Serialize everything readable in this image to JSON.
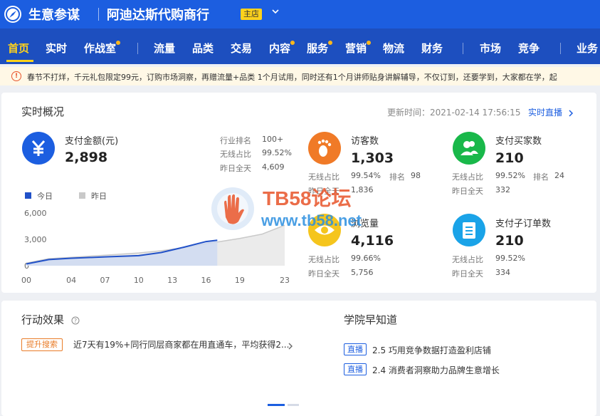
{
  "header": {
    "app_title": "生意参谋",
    "shop_name": "阿迪达斯代购商行",
    "shop_badge": "主店",
    "logo_icon": "compass-icon",
    "dropdown_icon": "chevron-down-icon"
  },
  "nav": {
    "items": [
      "首页",
      "实时",
      "作战室",
      "流量",
      "品类",
      "交易",
      "内容",
      "服务",
      "营销",
      "物流",
      "财务",
      "市场",
      "竞争",
      "业务"
    ],
    "active": "首页",
    "accent": "#ffd21c"
  },
  "notice": {
    "icon": "info-icon",
    "text": "春节不打烊，千元礼包限定99元，订购市场洞察，再赠流量+品类 1个月试用，同时还有1个月讲师贴身讲解辅导，不仅订到，还要学到，大家都在学，起"
  },
  "realtime": {
    "title": "实时概况",
    "update_time": "更新时间：2021-02-14 17:56:15",
    "live_link": "实时直播",
    "payment": {
      "label": "支付金额(元)",
      "value": "2,898",
      "icon": "yuan-icon",
      "rank_label": "行业排名",
      "rank_value": "100+",
      "wireless_label": "无线占比",
      "wireless_value": "99.52%",
      "yesterday_label": "昨日全天",
      "yesterday_value": "4,609"
    },
    "legend_today": "今日",
    "legend_yesterday": "昨日",
    "metrics": [
      {
        "label": "访客数",
        "value": "1,303",
        "icon": "footprint-icon",
        "color": "#f07a27",
        "wireless_label": "无线占比",
        "wireless_value": "99.54%",
        "rank_label": "排名",
        "rank_value": "98",
        "yesterday_label": "昨日全天",
        "yesterday_value": "1,836"
      },
      {
        "label": "支付买家数",
        "value": "210",
        "icon": "users-icon",
        "color": "#19b84a",
        "wireless_label": "无线占比",
        "wireless_value": "99.52%",
        "rank_label": "排名",
        "rank_value": "24",
        "yesterday_label": "昨日全天",
        "yesterday_value": "332"
      },
      {
        "label": "浏览量",
        "value": "4,116",
        "icon": "eye-icon",
        "color": "#f5c51d",
        "wireless_label": "无线占比",
        "wireless_value": "99.66%",
        "yesterday_label": "昨日全天",
        "yesterday_value": "5,756"
      },
      {
        "label": "支付子订单数",
        "value": "210",
        "icon": "clipboard-icon",
        "color": "#1aa3e8",
        "wireless_label": "无线占比",
        "wireless_value": "99.52%",
        "yesterday_label": "昨日全天",
        "yesterday_value": "334"
      }
    ]
  },
  "chart_data": {
    "type": "area",
    "x": [
      0,
      4,
      7,
      10,
      13,
      16,
      17,
      19,
      23
    ],
    "x_tick_labels": [
      "00",
      "04",
      "07",
      "10",
      "13",
      "16",
      "19",
      "23"
    ],
    "y_tick_labels": [
      "0",
      "3,000",
      "6,000"
    ],
    "ylim": [
      0,
      6000
    ],
    "xlim": [
      0,
      23
    ],
    "series": [
      {
        "name": "今日",
        "color": "#2151c8",
        "x": [
          0,
          2,
          4,
          7,
          10,
          12,
          14,
          16,
          17
        ],
        "values": [
          200,
          700,
          850,
          1000,
          1150,
          1500,
          2100,
          2750,
          2898
        ]
      },
      {
        "name": "昨日",
        "color": "#c9c9c9",
        "x": [
          0,
          2,
          4,
          7,
          10,
          12,
          14,
          16,
          17,
          19,
          21,
          23
        ],
        "values": [
          300,
          800,
          950,
          1200,
          1450,
          1700,
          2050,
          2500,
          2700,
          3100,
          3600,
          4609
        ]
      }
    ],
    "grid": false,
    "legend": "top-left"
  },
  "actions": {
    "title": "行动效果",
    "help_icon": "question-circle-icon",
    "tag": "提升搜索",
    "text": "近7天有19%+同行同层商家都在用直通车，平均获得2...",
    "arrow_icon": "chevron-right-icon"
  },
  "academy": {
    "title": "学院早知道",
    "items": [
      {
        "tag": "直播",
        "text": "2.5 巧用竞争数据打造盈利店铺"
      },
      {
        "tag": "直播",
        "text": "2.4 消费者洞察助力品牌生意增长"
      }
    ]
  },
  "watermark": {
    "line1": "TB58论坛",
    "line2": "www.tb58.net",
    "icon": "hand-logo-icon"
  }
}
